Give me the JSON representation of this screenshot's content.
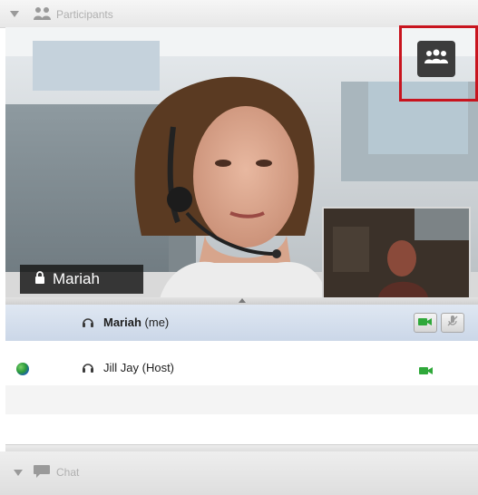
{
  "participants_panel": {
    "header_label": "Participants",
    "icon": "participants-icon"
  },
  "video": {
    "active_speaker_name": "Mariah",
    "lock_icon": "lock-icon",
    "layout_button_icon": "people-layout-icon"
  },
  "participants": [
    {
      "name": "Mariah",
      "suffix": "(me)",
      "icon": "headset-icon",
      "controls": [
        "video-camera-icon",
        "mute-mic-icon"
      ]
    },
    {
      "name": "Jill Jay (Host)",
      "icon": "headset-icon",
      "presence_icon": "globe-icon",
      "controls": [
        "video-camera-icon"
      ]
    }
  ],
  "chat_panel": {
    "header_label": "Chat",
    "icon": "chat-bubble-icon"
  },
  "colors": {
    "highlight": "#c8141e",
    "camera_green": "#2fa83a",
    "selected_row": "#d4deec"
  }
}
